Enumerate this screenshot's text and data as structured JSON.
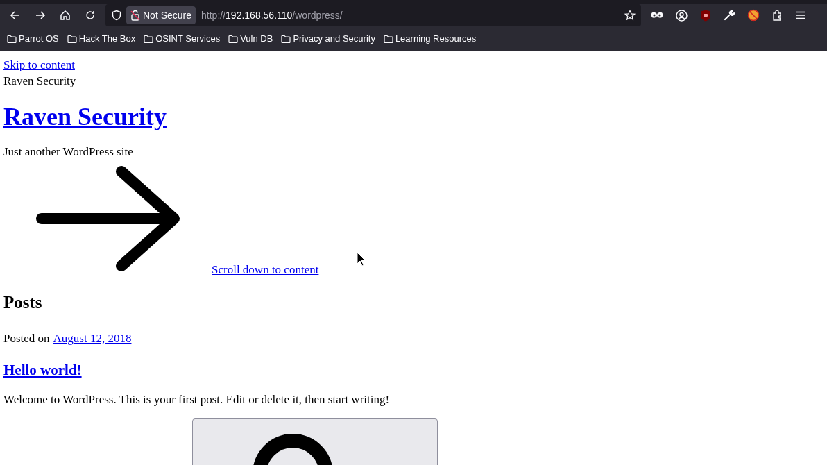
{
  "browser": {
    "security_label": "Not Secure",
    "url": {
      "scheme": "http://",
      "host": "192.168.56.110",
      "path": "/wordpress/"
    },
    "bookmarks": [
      "Parrot OS",
      "Hack The Box",
      "OSINT Services",
      "Vuln DB",
      "Privacy and Security",
      "Learning Resources"
    ]
  },
  "page": {
    "skip_link": "Skip to content",
    "site_name": "Raven Security",
    "site_title": "Raven Security",
    "tagline": "Just another WordPress site",
    "scroll_link": "Scroll down to content",
    "section_heading": "Posts",
    "post": {
      "posted_label": "Posted on",
      "date": "August 12, 2018",
      "title": "Hello world!",
      "excerpt": "Welcome to WordPress. This is your first post. Edit or delete it, then start writing!"
    }
  }
}
